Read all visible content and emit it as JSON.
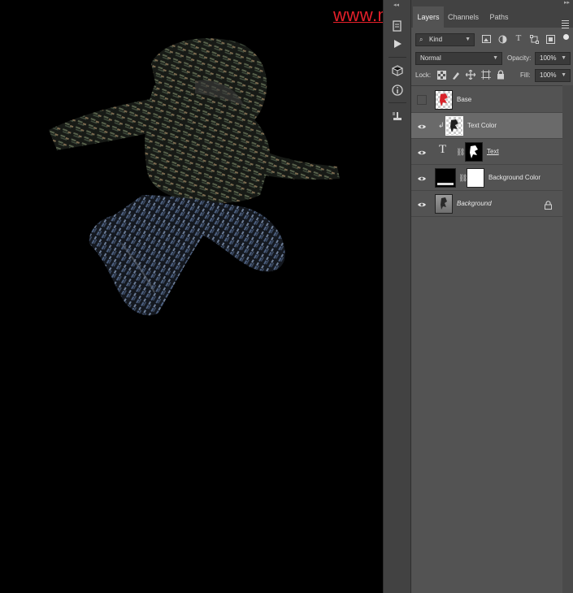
{
  "watermark": "www.moonbasha.com",
  "tabs": [
    {
      "label": "Layers",
      "active": true
    },
    {
      "label": "Channels",
      "active": false
    },
    {
      "label": "Paths",
      "active": false
    }
  ],
  "filter": {
    "kind_label": "Kind",
    "filter_icons": [
      "image-filter-icon",
      "adjustment-filter-icon",
      "type-filter-icon",
      "shape-filter-icon",
      "smart-object-filter-icon"
    ]
  },
  "blend": {
    "mode": "Normal",
    "opacity_label": "Opacity:",
    "opacity_value": "100%"
  },
  "lock": {
    "label": "Lock:",
    "fill_label": "Fill:",
    "fill_value": "100%"
  },
  "layers": [
    {
      "name": "Base",
      "visible": false,
      "selected": false,
      "clipped": false
    },
    {
      "name": "Text Color",
      "visible": true,
      "selected": true,
      "clipped": true
    },
    {
      "name": "Text",
      "visible": true,
      "selected": false,
      "type_layer": true
    },
    {
      "name": "Background Color",
      "visible": true,
      "selected": false
    },
    {
      "name": "Background",
      "visible": true,
      "selected": false,
      "locked": true
    }
  ],
  "tools": [
    "history-icon",
    "play-icon",
    "3d-cube-icon",
    "info-icon",
    "brush-presets-icon"
  ],
  "colors": {
    "accent_red": "#e4202a",
    "panel": "#535353",
    "selected_layer": "#6a6a6a"
  }
}
